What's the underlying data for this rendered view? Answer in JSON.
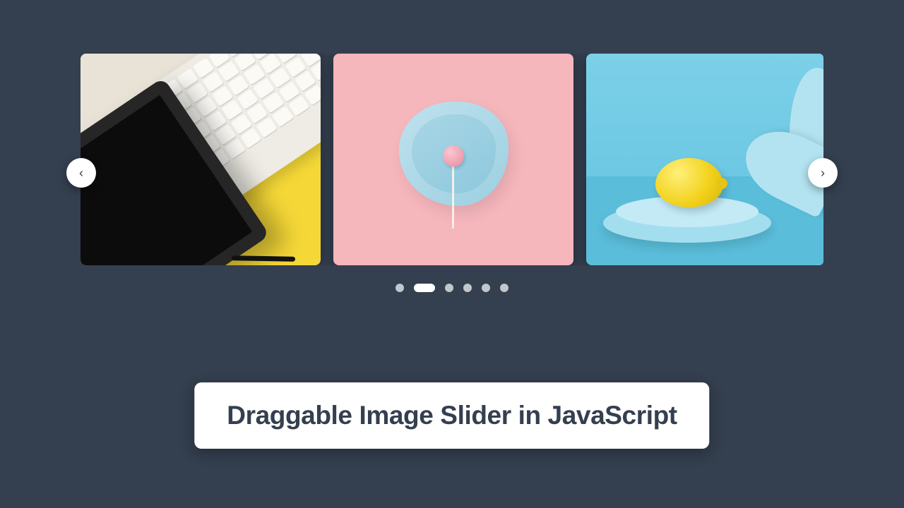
{
  "caption": {
    "text": "Draggable Image Slider in JavaScript"
  },
  "slider": {
    "prev_label": "Previous",
    "next_label": "Next",
    "active_index": 1,
    "total_dots": 6,
    "slides": [
      {
        "alt": "Tablet and keyboard on yellow surface"
      },
      {
        "alt": "Pink lollipop on blue dish, pink background"
      },
      {
        "alt": "Lemon on blue plates with glasses, blue background"
      }
    ]
  },
  "icons": {
    "chevron_left": "‹",
    "chevron_right": "›"
  }
}
